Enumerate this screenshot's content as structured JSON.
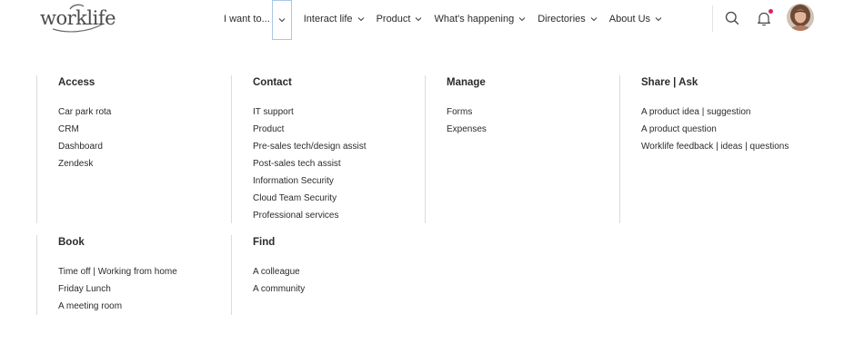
{
  "brand": {
    "logo_text": "worklife"
  },
  "nav": {
    "items": [
      {
        "label": "I want to..."
      },
      {
        "label": "Interact life"
      },
      {
        "label": "Product"
      },
      {
        "label": "What's happening"
      },
      {
        "label": "Directories"
      },
      {
        "label": "About Us"
      }
    ]
  },
  "header_icons": [
    "search-icon",
    "bell-icon",
    "avatar"
  ],
  "colors": {
    "notification_dot": "#d6245f",
    "active_outline": "#a9c7e8",
    "divider": "#dcdcdc"
  },
  "menu": {
    "access": {
      "title": "Access",
      "links": [
        "Car park rota",
        "CRM",
        "Dashboard",
        "Zendesk"
      ]
    },
    "contact": {
      "title": "Contact",
      "links": [
        "IT support",
        "Product",
        "Pre-sales tech/design assist",
        "Post-sales tech assist",
        "Information Security",
        "Cloud Team Security",
        "Professional services"
      ]
    },
    "manage": {
      "title": "Manage",
      "links": [
        "Forms",
        "Expenses"
      ]
    },
    "share": {
      "title": "Share | Ask",
      "links": [
        "A product idea | suggestion",
        "A product question",
        "Worklife feedback | ideas | questions"
      ]
    },
    "book": {
      "title": "Book",
      "links": [
        "Time off | Working from home",
        "Friday Lunch",
        "A meeting room"
      ]
    },
    "find": {
      "title": "Find",
      "links": [
        "A colleague",
        "A community"
      ]
    }
  }
}
